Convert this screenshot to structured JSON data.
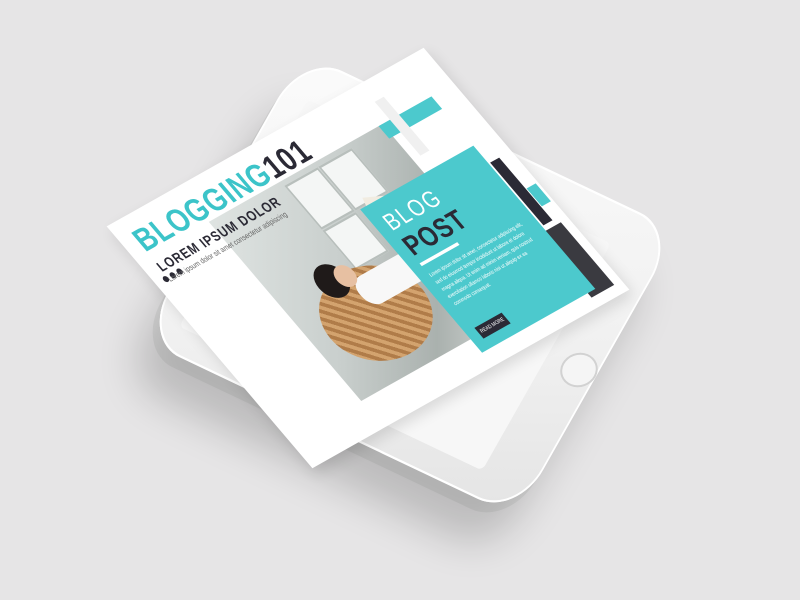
{
  "post": {
    "title_main": "BLOGGING",
    "title_num": "101",
    "subtitle": "LOREM IPSUM DOLOR",
    "tagline": "Lorem ipsum dolor sit amet consectetur adipiscing",
    "card_blog": "BLOG",
    "card_post": "POST",
    "card_text": "Lorem ipsum dolor sit amet, consectetur adipiscing elit, sed do eiusmod tempor incididunt ut labore et dolore magna aliqua. Ut enim ad minim veniam, quis nostrud exercitation ullamco laboris nisi ut aliquip ex ea commodo consequat.",
    "button_label": "READ MORE"
  },
  "colors": {
    "accent": "#4cc9cd",
    "dark": "#2b2a35",
    "background": "#e6e5e6"
  },
  "icons": {
    "dots": "three-dots-icon",
    "home": "home-button-icon"
  }
}
